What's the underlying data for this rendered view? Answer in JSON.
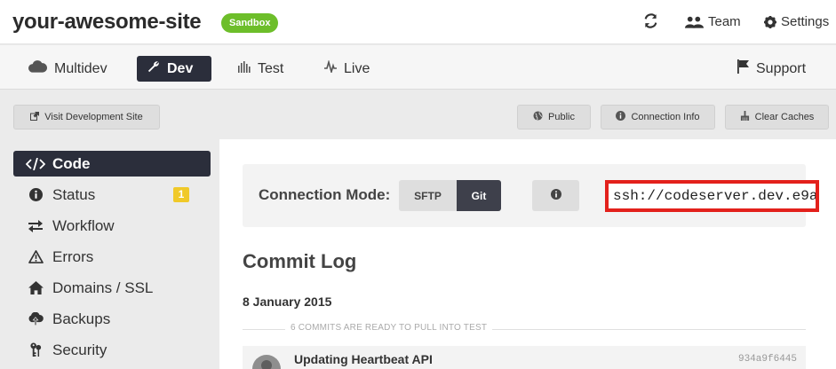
{
  "header": {
    "site_name": "your-awesome-site",
    "badge": "Sandbox",
    "team_label": "Team",
    "settings_label": "Settings"
  },
  "env_tabs": [
    {
      "label": "Multidev",
      "icon": "cloud-icon"
    },
    {
      "label": "Dev",
      "icon": "wrench-icon",
      "active": true
    },
    {
      "label": "Test",
      "icon": "bars-icon"
    },
    {
      "label": "Live",
      "icon": "pulse-icon"
    }
  ],
  "support_label": "Support",
  "actions": {
    "visit_label": "Visit Development Site",
    "public_label": "Public",
    "connection_info_label": "Connection Info",
    "clear_caches_label": "Clear Caches"
  },
  "sidebar": {
    "items": [
      {
        "label": "Code",
        "icon": "code-icon",
        "active": true
      },
      {
        "label": "Status",
        "icon": "info-icon",
        "badge": "1"
      },
      {
        "label": "Workflow",
        "icon": "workflow-icon"
      },
      {
        "label": "Errors",
        "icon": "warning-icon"
      },
      {
        "label": "Domains / SSL",
        "icon": "home-icon"
      },
      {
        "label": "Backups",
        "icon": "cloud-upload-icon"
      },
      {
        "label": "Security",
        "icon": "keys-icon"
      }
    ]
  },
  "connection": {
    "label": "Connection Mode:",
    "sftp_label": "SFTP",
    "git_label": "Git",
    "active_mode": "Git",
    "ssh_value": "ssh://codeserver.dev.e9a"
  },
  "commit_log": {
    "title": "Commit Log",
    "date": "8 January 2015",
    "ready_text": "6 COMMITS ARE READY TO PULL INTO TEST",
    "commits": [
      {
        "message": "Updating Heartbeat API",
        "hash": "934a9f6445"
      }
    ]
  },
  "colors": {
    "accent_dark": "#2b2e3b",
    "sandbox_green": "#6dbe2a",
    "badge_yellow": "#f0c929",
    "highlight_red": "#e3201b"
  }
}
